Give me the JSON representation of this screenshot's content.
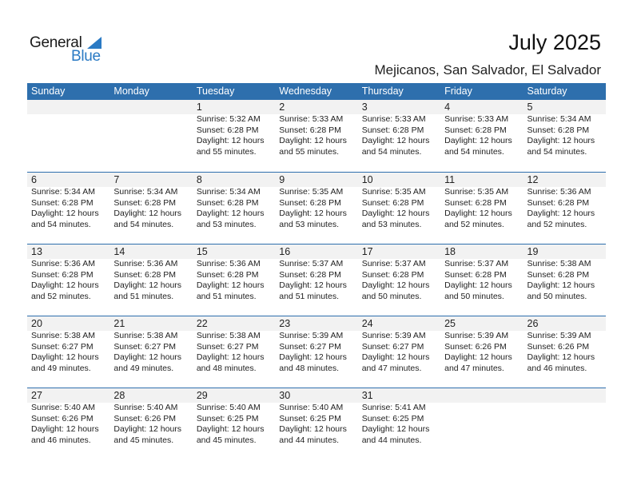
{
  "logo": {
    "general": "General",
    "blue": "Blue"
  },
  "header": {
    "title": "July 2025",
    "subtitle": "Mejicanos, San Salvador, El Salvador"
  },
  "colors": {
    "header_bg": "#2e6fad",
    "band_bg": "#f2f2f2",
    "logo_blue": "#2a7ac4"
  },
  "weekdays": [
    "Sunday",
    "Monday",
    "Tuesday",
    "Wednesday",
    "Thursday",
    "Friday",
    "Saturday"
  ],
  "weeks": [
    [
      null,
      null,
      {
        "day": "1",
        "sunrise": "Sunrise: 5:32 AM",
        "sunset": "Sunset: 6:28 PM",
        "daylight1": "Daylight: 12 hours",
        "daylight2": "and 55 minutes."
      },
      {
        "day": "2",
        "sunrise": "Sunrise: 5:33 AM",
        "sunset": "Sunset: 6:28 PM",
        "daylight1": "Daylight: 12 hours",
        "daylight2": "and 55 minutes."
      },
      {
        "day": "3",
        "sunrise": "Sunrise: 5:33 AM",
        "sunset": "Sunset: 6:28 PM",
        "daylight1": "Daylight: 12 hours",
        "daylight2": "and 54 minutes."
      },
      {
        "day": "4",
        "sunrise": "Sunrise: 5:33 AM",
        "sunset": "Sunset: 6:28 PM",
        "daylight1": "Daylight: 12 hours",
        "daylight2": "and 54 minutes."
      },
      {
        "day": "5",
        "sunrise": "Sunrise: 5:34 AM",
        "sunset": "Sunset: 6:28 PM",
        "daylight1": "Daylight: 12 hours",
        "daylight2": "and 54 minutes."
      }
    ],
    [
      {
        "day": "6",
        "sunrise": "Sunrise: 5:34 AM",
        "sunset": "Sunset: 6:28 PM",
        "daylight1": "Daylight: 12 hours",
        "daylight2": "and 54 minutes."
      },
      {
        "day": "7",
        "sunrise": "Sunrise: 5:34 AM",
        "sunset": "Sunset: 6:28 PM",
        "daylight1": "Daylight: 12 hours",
        "daylight2": "and 54 minutes."
      },
      {
        "day": "8",
        "sunrise": "Sunrise: 5:34 AM",
        "sunset": "Sunset: 6:28 PM",
        "daylight1": "Daylight: 12 hours",
        "daylight2": "and 53 minutes."
      },
      {
        "day": "9",
        "sunrise": "Sunrise: 5:35 AM",
        "sunset": "Sunset: 6:28 PM",
        "daylight1": "Daylight: 12 hours",
        "daylight2": "and 53 minutes."
      },
      {
        "day": "10",
        "sunrise": "Sunrise: 5:35 AM",
        "sunset": "Sunset: 6:28 PM",
        "daylight1": "Daylight: 12 hours",
        "daylight2": "and 53 minutes."
      },
      {
        "day": "11",
        "sunrise": "Sunrise: 5:35 AM",
        "sunset": "Sunset: 6:28 PM",
        "daylight1": "Daylight: 12 hours",
        "daylight2": "and 52 minutes."
      },
      {
        "day": "12",
        "sunrise": "Sunrise: 5:36 AM",
        "sunset": "Sunset: 6:28 PM",
        "daylight1": "Daylight: 12 hours",
        "daylight2": "and 52 minutes."
      }
    ],
    [
      {
        "day": "13",
        "sunrise": "Sunrise: 5:36 AM",
        "sunset": "Sunset: 6:28 PM",
        "daylight1": "Daylight: 12 hours",
        "daylight2": "and 52 minutes."
      },
      {
        "day": "14",
        "sunrise": "Sunrise: 5:36 AM",
        "sunset": "Sunset: 6:28 PM",
        "daylight1": "Daylight: 12 hours",
        "daylight2": "and 51 minutes."
      },
      {
        "day": "15",
        "sunrise": "Sunrise: 5:36 AM",
        "sunset": "Sunset: 6:28 PM",
        "daylight1": "Daylight: 12 hours",
        "daylight2": "and 51 minutes."
      },
      {
        "day": "16",
        "sunrise": "Sunrise: 5:37 AM",
        "sunset": "Sunset: 6:28 PM",
        "daylight1": "Daylight: 12 hours",
        "daylight2": "and 51 minutes."
      },
      {
        "day": "17",
        "sunrise": "Sunrise: 5:37 AM",
        "sunset": "Sunset: 6:28 PM",
        "daylight1": "Daylight: 12 hours",
        "daylight2": "and 50 minutes."
      },
      {
        "day": "18",
        "sunrise": "Sunrise: 5:37 AM",
        "sunset": "Sunset: 6:28 PM",
        "daylight1": "Daylight: 12 hours",
        "daylight2": "and 50 minutes."
      },
      {
        "day": "19",
        "sunrise": "Sunrise: 5:38 AM",
        "sunset": "Sunset: 6:28 PM",
        "daylight1": "Daylight: 12 hours",
        "daylight2": "and 50 minutes."
      }
    ],
    [
      {
        "day": "20",
        "sunrise": "Sunrise: 5:38 AM",
        "sunset": "Sunset: 6:27 PM",
        "daylight1": "Daylight: 12 hours",
        "daylight2": "and 49 minutes."
      },
      {
        "day": "21",
        "sunrise": "Sunrise: 5:38 AM",
        "sunset": "Sunset: 6:27 PM",
        "daylight1": "Daylight: 12 hours",
        "daylight2": "and 49 minutes."
      },
      {
        "day": "22",
        "sunrise": "Sunrise: 5:38 AM",
        "sunset": "Sunset: 6:27 PM",
        "daylight1": "Daylight: 12 hours",
        "daylight2": "and 48 minutes."
      },
      {
        "day": "23",
        "sunrise": "Sunrise: 5:39 AM",
        "sunset": "Sunset: 6:27 PM",
        "daylight1": "Daylight: 12 hours",
        "daylight2": "and 48 minutes."
      },
      {
        "day": "24",
        "sunrise": "Sunrise: 5:39 AM",
        "sunset": "Sunset: 6:27 PM",
        "daylight1": "Daylight: 12 hours",
        "daylight2": "and 47 minutes."
      },
      {
        "day": "25",
        "sunrise": "Sunrise: 5:39 AM",
        "sunset": "Sunset: 6:26 PM",
        "daylight1": "Daylight: 12 hours",
        "daylight2": "and 47 minutes."
      },
      {
        "day": "26",
        "sunrise": "Sunrise: 5:39 AM",
        "sunset": "Sunset: 6:26 PM",
        "daylight1": "Daylight: 12 hours",
        "daylight2": "and 46 minutes."
      }
    ],
    [
      {
        "day": "27",
        "sunrise": "Sunrise: 5:40 AM",
        "sunset": "Sunset: 6:26 PM",
        "daylight1": "Daylight: 12 hours",
        "daylight2": "and 46 minutes."
      },
      {
        "day": "28",
        "sunrise": "Sunrise: 5:40 AM",
        "sunset": "Sunset: 6:26 PM",
        "daylight1": "Daylight: 12 hours",
        "daylight2": "and 45 minutes."
      },
      {
        "day": "29",
        "sunrise": "Sunrise: 5:40 AM",
        "sunset": "Sunset: 6:25 PM",
        "daylight1": "Daylight: 12 hours",
        "daylight2": "and 45 minutes."
      },
      {
        "day": "30",
        "sunrise": "Sunrise: 5:40 AM",
        "sunset": "Sunset: 6:25 PM",
        "daylight1": "Daylight: 12 hours",
        "daylight2": "and 44 minutes."
      },
      {
        "day": "31",
        "sunrise": "Sunrise: 5:41 AM",
        "sunset": "Sunset: 6:25 PM",
        "daylight1": "Daylight: 12 hours",
        "daylight2": "and 44 minutes."
      },
      null,
      null
    ]
  ]
}
